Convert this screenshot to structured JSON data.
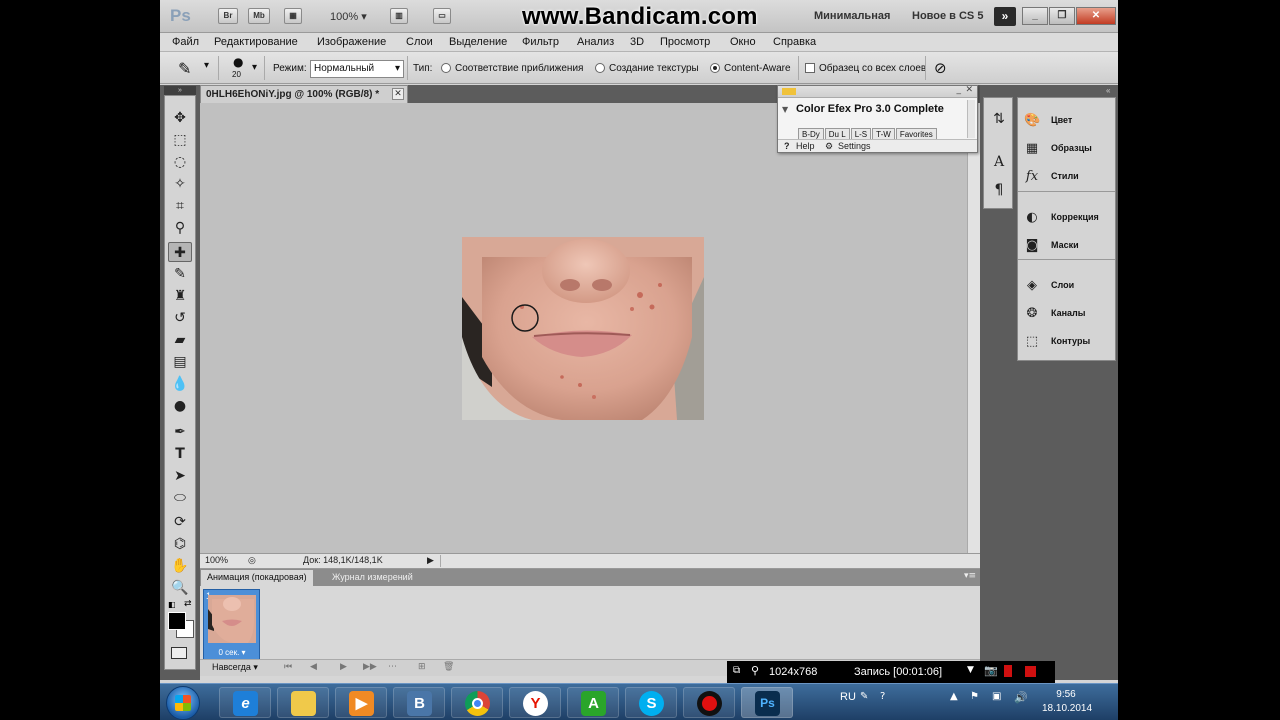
{
  "app": {
    "logo": "Ps",
    "mini_buttons": [
      "Br",
      "Mb"
    ],
    "zoom": "100%",
    "watermark": "www.Bandicam.com",
    "workspaces": [
      "Минимальная",
      "Новое в CS 5"
    ],
    "more_label": "»"
  },
  "menu": [
    "Файл",
    "Редактирование",
    "Изображение",
    "Слои",
    "Выделение",
    "Фильтр",
    "Анализ",
    "3D",
    "Просмотр",
    "Окно",
    "Справка"
  ],
  "options": {
    "brush_size": "20",
    "mode_label": "Режим:",
    "mode_value": "Нормальный",
    "type_label": "Тип:",
    "radio1": "Соответствие приближения",
    "radio2": "Создание текстуры",
    "radio3": "Content-Aware",
    "sample_all": "Образец со всех слоев"
  },
  "document": {
    "tab_title": "0HLH6EhONiY.jpg @ 100% (RGB/8) *",
    "zoom": "100%",
    "doc_size": "Док: 148,1K/148,1K"
  },
  "color_efex": {
    "title": "Color Efex Pro 3.0 Complete",
    "tabs": [
      "B-Dy",
      "Du L",
      "L-S",
      "T-W",
      "Favorites"
    ],
    "help": "Help",
    "settings": "Settings"
  },
  "panels": {
    "group1": [
      "Цвет",
      "Образцы",
      "Стили"
    ],
    "group2": [
      "Коррекция",
      "Маски"
    ],
    "group3": [
      "Слои",
      "Каналы",
      "Контуры"
    ]
  },
  "animation": {
    "tab_active": "Анимация (покадровая)",
    "tab_other": "Журнал измерений",
    "frame_number": "1",
    "frame_time": "0 сек.",
    "loop": "Навсегда"
  },
  "bandicam": {
    "resolution": "1024x768",
    "record": "Запись [00:01:06]"
  },
  "taskbar": {
    "lang": "RU",
    "time": "9:56",
    "date": "18.10.2014"
  }
}
